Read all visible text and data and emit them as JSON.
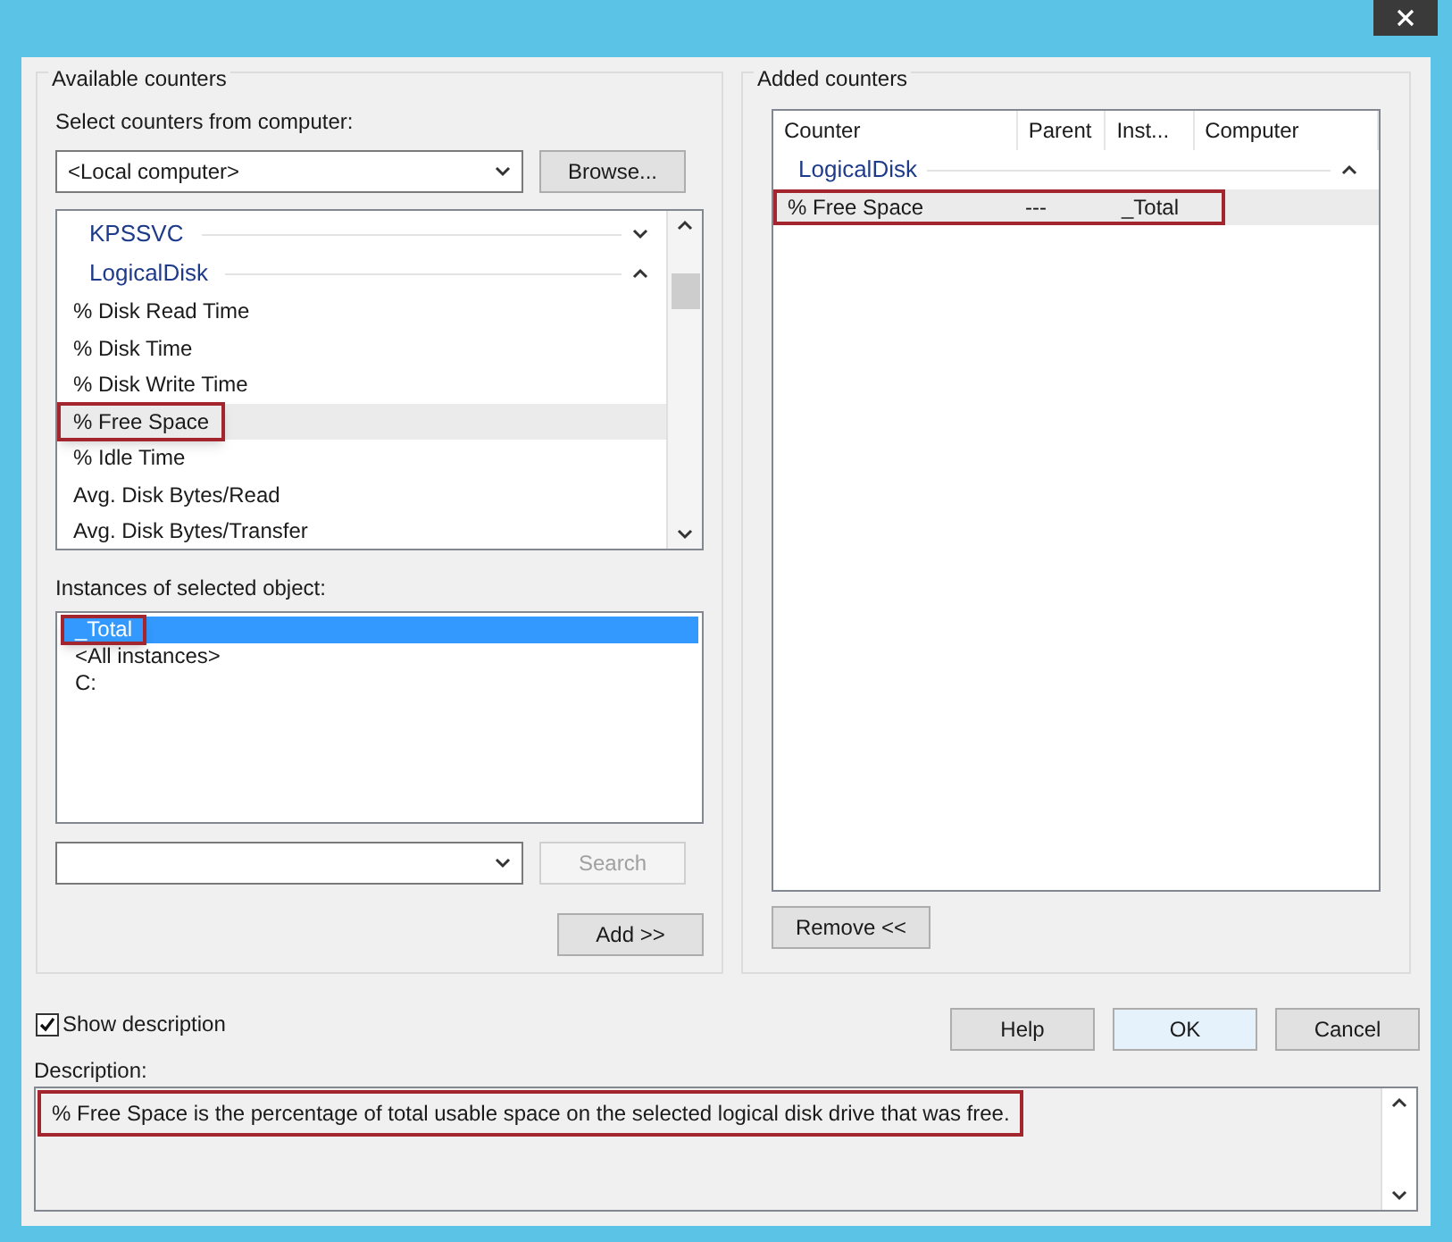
{
  "available_counters": {
    "title": "Available counters",
    "computer_label": "Select counters from computer:",
    "computer_value": "<Local computer>",
    "browse_button": "Browse...",
    "counter_list": [
      {
        "kind": "group",
        "label": "KPSSVC",
        "expanded": false,
        "selected": false,
        "highlighted": false
      },
      {
        "kind": "group",
        "label": "LogicalDisk",
        "expanded": true,
        "selected": false,
        "highlighted": false
      },
      {
        "kind": "counter",
        "label": "% Disk Read Time",
        "selected": false,
        "highlighted": false
      },
      {
        "kind": "counter",
        "label": "% Disk Time",
        "selected": false,
        "highlighted": false
      },
      {
        "kind": "counter",
        "label": "% Disk Write Time",
        "selected": false,
        "highlighted": false
      },
      {
        "kind": "counter",
        "label": "% Free Space",
        "selected": true,
        "highlighted": true
      },
      {
        "kind": "counter",
        "label": "% Idle Time",
        "selected": false,
        "highlighted": false
      },
      {
        "kind": "counter",
        "label": "Avg. Disk Bytes/Read",
        "selected": false,
        "highlighted": false
      },
      {
        "kind": "counter",
        "label": "Avg. Disk Bytes/Transfer",
        "selected": false,
        "highlighted": false
      }
    ],
    "instances_label": "Instances of selected object:",
    "instances": [
      {
        "label": "_Total",
        "selected": true,
        "highlighted": true
      },
      {
        "label": "<All instances>",
        "selected": false,
        "highlighted": false
      },
      {
        "label": "C:",
        "selected": false,
        "highlighted": false
      }
    ],
    "search_button": {
      "label": "Search",
      "disabled": true
    },
    "add_button": "Add >>"
  },
  "added_counters": {
    "title": "Added counters",
    "columns": [
      "Counter",
      "Parent",
      "Inst...",
      "Computer"
    ],
    "groups": [
      {
        "label": "LogicalDisk",
        "expanded": true,
        "rows": [
          {
            "cells": [
              "% Free Space",
              "---",
              "_Total"
            ],
            "selected": true,
            "highlighted": true
          }
        ]
      }
    ],
    "remove_button": "Remove <<"
  },
  "show_description": {
    "label": "Show description",
    "checked": true
  },
  "buttons": [
    "Help",
    "OK",
    "Cancel"
  ],
  "description": {
    "label": "Description:",
    "text": "% Free Space is the percentage of total usable space on the selected logical disk drive that was free.",
    "highlighted": true
  }
}
